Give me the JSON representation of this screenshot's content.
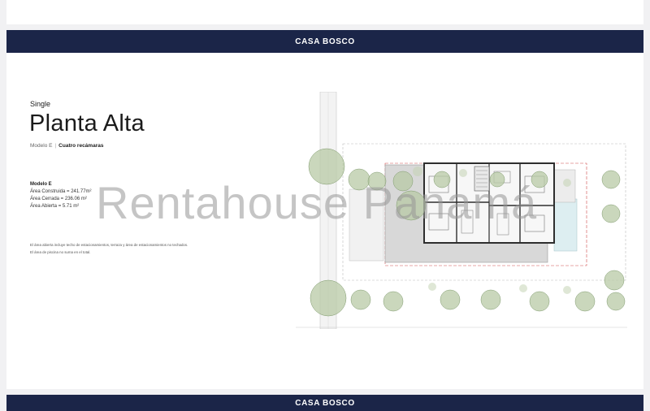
{
  "header": {
    "title": "CASA BOSCO"
  },
  "content": {
    "kicker": "Single",
    "title": "Planta Alta",
    "model_short": "Modelo E",
    "model_desc": "Cuatro recámaras",
    "specs_heading": "Modelo E",
    "specs": [
      "Área Construida = 241.77m²",
      "Área Cerrada = 236.06 m²",
      "Área Abierta = 5.71 m²"
    ],
    "notes": [
      "El área abierta incluye techo de estacionamientos, terraza y área de estacionamientos no techados.",
      "El área de piscina no suma en el total."
    ]
  },
  "watermark": "Rentahouse Panamá",
  "next_page": {
    "title": "CASA BOSCO"
  },
  "colors": {
    "navy": "#1b2548",
    "tree": "#b8c9a6"
  }
}
